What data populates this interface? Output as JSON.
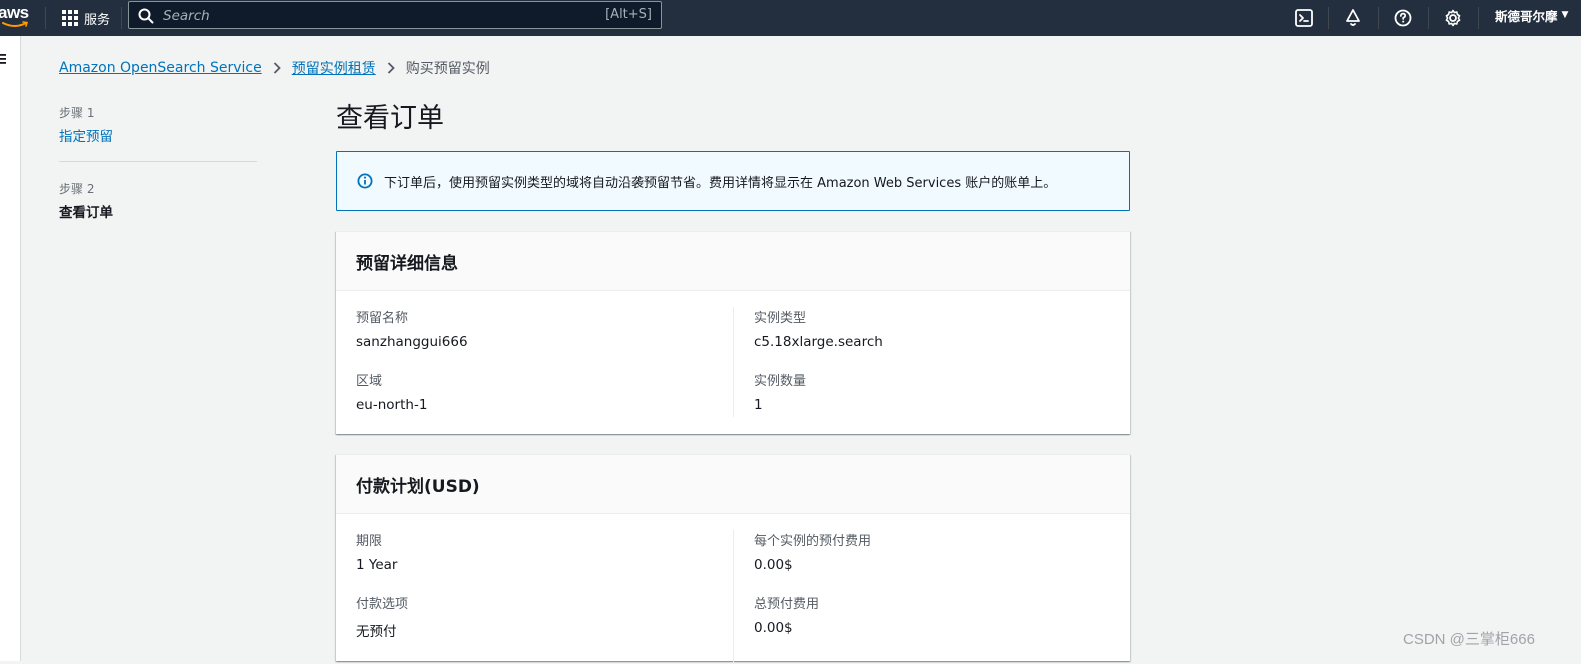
{
  "nav": {
    "logo_text": "aws",
    "services_label": "服务",
    "search_placeholder": "Search",
    "search_shortcut": "[Alt+S]",
    "user_name": "斯德哥尔摩"
  },
  "breadcrumb": {
    "items": [
      "Amazon OpenSearch Service",
      "预留实例租赁"
    ],
    "current": "购买预留实例"
  },
  "steps": [
    {
      "label": "步骤 1",
      "name": "指定预留"
    },
    {
      "label": "步骤 2",
      "name": "查看订单"
    }
  ],
  "page_title": "查看订单",
  "info_alert": "下订单后，使用预留实例类型的域将自动沿袭预留节省。费用详情将显示在 Amazon Web Services 账户的账单上。",
  "reservation": {
    "title": "预留详细信息",
    "name_label": "预留名称",
    "name_value": "sanzhanggui666",
    "region_label": "区域",
    "region_value": "eu-north-1",
    "type_label": "实例类型",
    "type_value": "c5.18xlarge.search",
    "count_label": "实例数量",
    "count_value": "1"
  },
  "payment": {
    "title": "付款计划(USD)",
    "term_label": "期限",
    "term_value": "1 Year",
    "option_label": "付款选项",
    "option_value": "无预付",
    "upfront_label": "每个实例的预付费用",
    "upfront_value": "0.00$",
    "total_label": "总预付费用",
    "total_value": "0.00$"
  },
  "watermark": "CSDN @三掌柜666",
  "colors": {
    "nav_bg": "#232f3e",
    "link": "#0073bb",
    "page_bg": "#f2f3f3",
    "info_bg": "#f1faff",
    "aws_orange": "#ff9900"
  }
}
